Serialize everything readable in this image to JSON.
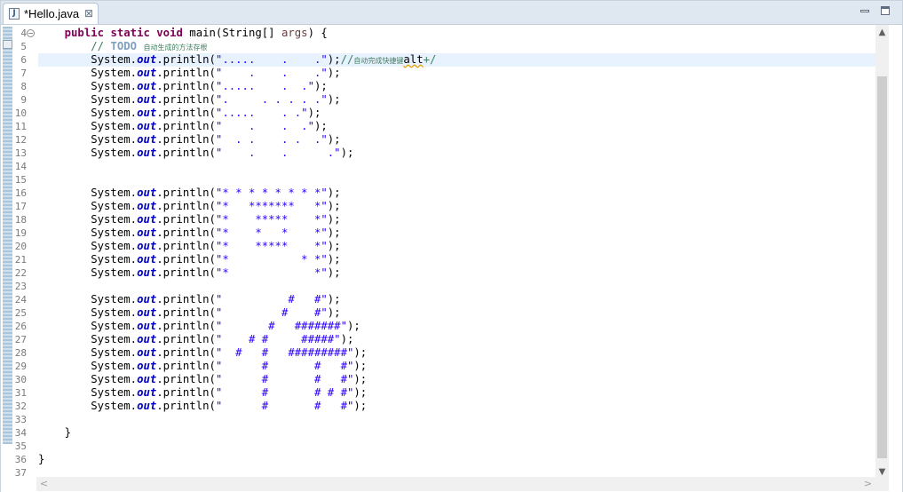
{
  "tab": {
    "title": "*Hello.java",
    "icon": "java-file-icon",
    "close_glyph": "⊠"
  },
  "window_controls": {
    "minimize": "minimize-icon",
    "maximize": "maximize-icon"
  },
  "colors": {
    "keyword": "#7f0055",
    "comment": "#3f7f5f",
    "string": "#2a00ff",
    "field": "#0000c0",
    "current_line": "#e8f2fe",
    "line_number": "#7a7a7a"
  },
  "scrollbars": {
    "up": "▲",
    "down": "▼",
    "left": "<",
    "right": ">"
  },
  "editor": {
    "current_line": 6,
    "lines": [
      {
        "n": "4",
        "tokens": [
          [
            "plain",
            "    "
          ],
          [
            "kw",
            "public"
          ],
          [
            "plain",
            " "
          ],
          [
            "kw",
            "static"
          ],
          [
            "plain",
            " "
          ],
          [
            "kw",
            "void"
          ],
          [
            "plain",
            " main(String[] "
          ],
          [
            "param",
            "args"
          ],
          [
            "plain",
            ") {"
          ]
        ]
      },
      {
        "n": "5",
        "tokens": [
          [
            "plain",
            "        "
          ],
          [
            "cm",
            "// "
          ],
          [
            "todo",
            "TODO"
          ],
          [
            "plain",
            " "
          ],
          [
            "cmsmall",
            "自动生成的方法存根"
          ]
        ]
      },
      {
        "n": "6",
        "tokens": [
          [
            "plain",
            "        System."
          ],
          [
            "fld",
            "out"
          ],
          [
            "plain",
            ".println("
          ],
          [
            "str",
            "\".....    .    .\""
          ],
          [
            "plain",
            ");"
          ],
          [
            "cm",
            "//"
          ],
          [
            "cmsmall",
            "自动完成快捷键"
          ],
          [
            "spell",
            "alt"
          ],
          [
            "cm",
            "+/"
          ]
        ]
      },
      {
        "n": "7",
        "tokens": [
          [
            "plain",
            "        System."
          ],
          [
            "fld",
            "out"
          ],
          [
            "plain",
            ".println("
          ],
          [
            "str",
            "\"    .    .    .\""
          ],
          [
            "plain",
            ");"
          ]
        ]
      },
      {
        "n": "8",
        "tokens": [
          [
            "plain",
            "        System."
          ],
          [
            "fld",
            "out"
          ],
          [
            "plain",
            ".println("
          ],
          [
            "str",
            "\".....    .  .\""
          ],
          [
            "plain",
            ");"
          ]
        ]
      },
      {
        "n": "9",
        "tokens": [
          [
            "plain",
            "        System."
          ],
          [
            "fld",
            "out"
          ],
          [
            "plain",
            ".println("
          ],
          [
            "str",
            "\".     . . . . .\""
          ],
          [
            "plain",
            ");"
          ]
        ]
      },
      {
        "n": "10",
        "tokens": [
          [
            "plain",
            "        System."
          ],
          [
            "fld",
            "out"
          ],
          [
            "plain",
            ".println("
          ],
          [
            "str",
            "\".....    . .\""
          ],
          [
            "plain",
            ");"
          ]
        ]
      },
      {
        "n": "11",
        "tokens": [
          [
            "plain",
            "        System."
          ],
          [
            "fld",
            "out"
          ],
          [
            "plain",
            ".println("
          ],
          [
            "str",
            "\"    .    .  .\""
          ],
          [
            "plain",
            ");"
          ]
        ]
      },
      {
        "n": "12",
        "tokens": [
          [
            "plain",
            "        System."
          ],
          [
            "fld",
            "out"
          ],
          [
            "plain",
            ".println("
          ],
          [
            "str",
            "\"  . .    . .  .\""
          ],
          [
            "plain",
            ");"
          ]
        ]
      },
      {
        "n": "13",
        "tokens": [
          [
            "plain",
            "        System."
          ],
          [
            "fld",
            "out"
          ],
          [
            "plain",
            ".println("
          ],
          [
            "str",
            "\"    .    .      .\""
          ],
          [
            "plain",
            ");"
          ]
        ]
      },
      {
        "n": "14",
        "tokens": []
      },
      {
        "n": "15",
        "tokens": []
      },
      {
        "n": "16",
        "tokens": [
          [
            "plain",
            "        System."
          ],
          [
            "fld",
            "out"
          ],
          [
            "plain",
            ".println("
          ],
          [
            "str",
            "\"* * * * * * * *\""
          ],
          [
            "plain",
            ");"
          ]
        ]
      },
      {
        "n": "17",
        "tokens": [
          [
            "plain",
            "        System."
          ],
          [
            "fld",
            "out"
          ],
          [
            "plain",
            ".println("
          ],
          [
            "str",
            "\"*   *******   *\""
          ],
          [
            "plain",
            ");"
          ]
        ]
      },
      {
        "n": "18",
        "tokens": [
          [
            "plain",
            "        System."
          ],
          [
            "fld",
            "out"
          ],
          [
            "plain",
            ".println("
          ],
          [
            "str",
            "\"*    *****    *\""
          ],
          [
            "plain",
            ");"
          ]
        ]
      },
      {
        "n": "19",
        "tokens": [
          [
            "plain",
            "        System."
          ],
          [
            "fld",
            "out"
          ],
          [
            "plain",
            ".println("
          ],
          [
            "str",
            "\"*    *   *    *\""
          ],
          [
            "plain",
            ");"
          ]
        ]
      },
      {
        "n": "20",
        "tokens": [
          [
            "plain",
            "        System."
          ],
          [
            "fld",
            "out"
          ],
          [
            "plain",
            ".println("
          ],
          [
            "str",
            "\"*    *****    *\""
          ],
          [
            "plain",
            ");"
          ]
        ]
      },
      {
        "n": "21",
        "tokens": [
          [
            "plain",
            "        System."
          ],
          [
            "fld",
            "out"
          ],
          [
            "plain",
            ".println("
          ],
          [
            "str",
            "\"*           * *\""
          ],
          [
            "plain",
            ");"
          ]
        ]
      },
      {
        "n": "22",
        "tokens": [
          [
            "plain",
            "        System."
          ],
          [
            "fld",
            "out"
          ],
          [
            "plain",
            ".println("
          ],
          [
            "str",
            "\"*             *\""
          ],
          [
            "plain",
            ");"
          ]
        ]
      },
      {
        "n": "23",
        "tokens": []
      },
      {
        "n": "24",
        "tokens": [
          [
            "plain",
            "        System."
          ],
          [
            "fld",
            "out"
          ],
          [
            "plain",
            ".println("
          ],
          [
            "str",
            "\"          #   #\""
          ],
          [
            "plain",
            ");"
          ]
        ]
      },
      {
        "n": "25",
        "tokens": [
          [
            "plain",
            "        System."
          ],
          [
            "fld",
            "out"
          ],
          [
            "plain",
            ".println("
          ],
          [
            "str",
            "\"         #    #\""
          ],
          [
            "plain",
            ");"
          ]
        ]
      },
      {
        "n": "26",
        "tokens": [
          [
            "plain",
            "        System."
          ],
          [
            "fld",
            "out"
          ],
          [
            "plain",
            ".println("
          ],
          [
            "str",
            "\"       #   #######\""
          ],
          [
            "plain",
            ");"
          ]
        ]
      },
      {
        "n": "27",
        "tokens": [
          [
            "plain",
            "        System."
          ],
          [
            "fld",
            "out"
          ],
          [
            "plain",
            ".println("
          ],
          [
            "str",
            "\"    # #     #####\""
          ],
          [
            "plain",
            ");"
          ]
        ]
      },
      {
        "n": "28",
        "tokens": [
          [
            "plain",
            "        System."
          ],
          [
            "fld",
            "out"
          ],
          [
            "plain",
            ".println("
          ],
          [
            "str",
            "\"  #   #   #########\""
          ],
          [
            "plain",
            ");"
          ]
        ]
      },
      {
        "n": "29",
        "tokens": [
          [
            "plain",
            "        System."
          ],
          [
            "fld",
            "out"
          ],
          [
            "plain",
            ".println("
          ],
          [
            "str",
            "\"      #       #   #\""
          ],
          [
            "plain",
            ");"
          ]
        ]
      },
      {
        "n": "30",
        "tokens": [
          [
            "plain",
            "        System."
          ],
          [
            "fld",
            "out"
          ],
          [
            "plain",
            ".println("
          ],
          [
            "str",
            "\"      #       #   #\""
          ],
          [
            "plain",
            ");"
          ]
        ]
      },
      {
        "n": "31",
        "tokens": [
          [
            "plain",
            "        System."
          ],
          [
            "fld",
            "out"
          ],
          [
            "plain",
            ".println("
          ],
          [
            "str",
            "\"      #       # # #\""
          ],
          [
            "plain",
            ");"
          ]
        ]
      },
      {
        "n": "32",
        "tokens": [
          [
            "plain",
            "        System."
          ],
          [
            "fld",
            "out"
          ],
          [
            "plain",
            ".println("
          ],
          [
            "str",
            "\"      #       #   #\""
          ],
          [
            "plain",
            ");"
          ]
        ]
      },
      {
        "n": "33",
        "tokens": []
      },
      {
        "n": "34",
        "tokens": [
          [
            "plain",
            "    }"
          ]
        ]
      },
      {
        "n": "35",
        "tokens": []
      },
      {
        "n": "36",
        "tokens": [
          [
            "plain",
            "}"
          ]
        ]
      },
      {
        "n": "37",
        "tokens": []
      }
    ]
  }
}
